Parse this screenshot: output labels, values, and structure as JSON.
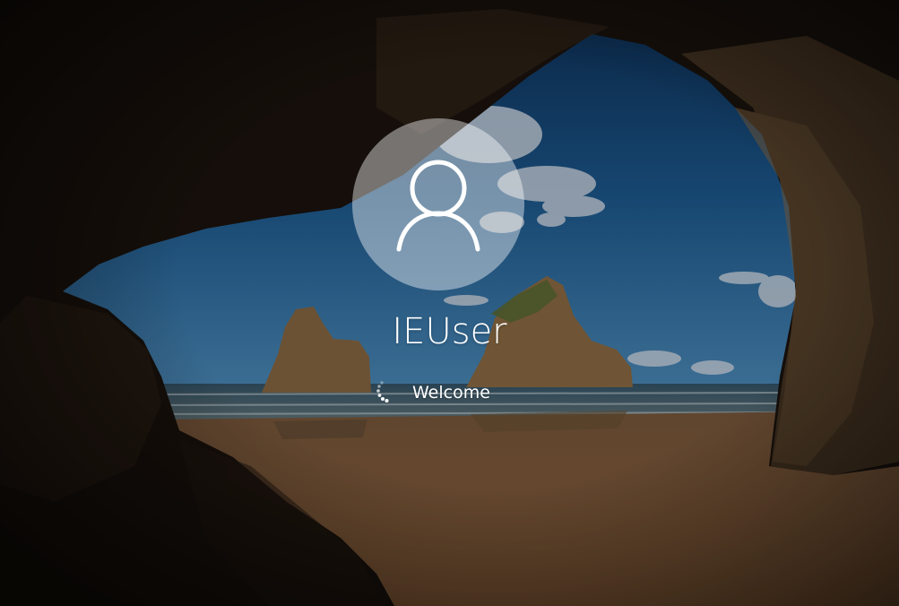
{
  "login": {
    "username": "IEUser",
    "status_text": "Welcome"
  },
  "icons": {
    "avatar": "user-avatar-icon",
    "spinner": "loading-spinner-icon"
  },
  "colors": {
    "text": "#ffffff",
    "avatar_fill": "rgba(255,255,255,0.42)",
    "sky": "#1f5a8a",
    "sand": "#9a6f45"
  }
}
